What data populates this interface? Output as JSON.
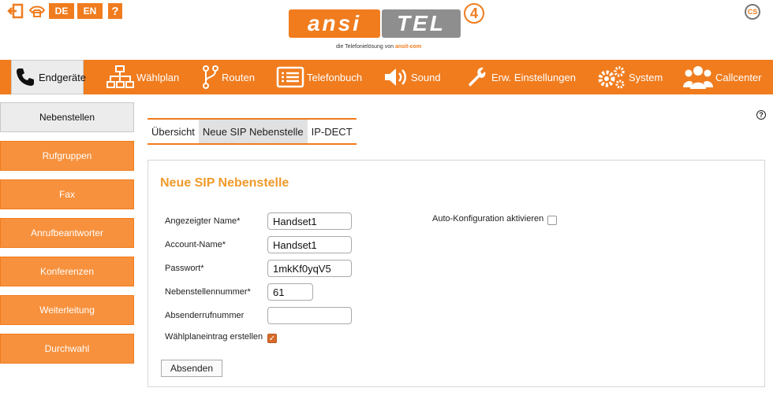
{
  "topbar": {
    "lang_de": "DE",
    "lang_en": "EN",
    "help_label": "?",
    "logo_ansi": "ansi",
    "logo_tel": "TEL",
    "logo_version": "4",
    "tagline_prefix": "die Telefonielösung von",
    "tagline_brand": "ansit-com",
    "cs_logo": "CS"
  },
  "nav": [
    {
      "label": "Endgeräte",
      "icon": "phone-icon",
      "active": true
    },
    {
      "label": "Wählplan",
      "icon": "sitemap-icon"
    },
    {
      "label": "Routen",
      "icon": "route-icon"
    },
    {
      "label": "Telefonbuch",
      "icon": "list-icon"
    },
    {
      "label": "Sound",
      "icon": "speaker-icon"
    },
    {
      "label": "Erw. Einstellungen",
      "icon": "wrench-icon"
    },
    {
      "label": "System",
      "icon": "gears-icon"
    },
    {
      "label": "Callcenter",
      "icon": "users-icon"
    }
  ],
  "sidebar": [
    {
      "label": "Nebenstellen",
      "active": true
    },
    {
      "label": "Rufgruppen"
    },
    {
      "label": "Fax"
    },
    {
      "label": "Anrufbeantworter"
    },
    {
      "label": "Konferenzen"
    },
    {
      "label": "Weiterleitung"
    },
    {
      "label": "Durchwahl"
    }
  ],
  "tabs": [
    {
      "label": "Übersicht"
    },
    {
      "label": "Neue SIP Nebenstelle",
      "active": true
    },
    {
      "label": "IP-DECT"
    }
  ],
  "form": {
    "title": "Neue SIP Nebenstelle",
    "display_name_label": "Angezeigter Name*",
    "display_name_value": "Handset1",
    "account_name_label": "Account-Name*",
    "account_name_value": "Handset1",
    "password_label": "Passwort*",
    "password_value": "1mkKf0yqV5",
    "extension_label": "Nebenstellennummer*",
    "extension_value": "61",
    "caller_number_label": "Absenderrufnummer",
    "caller_number_value": "",
    "dialplan_entry_label": "Wählplaneintrag erstellen",
    "dialplan_entry_checked": true,
    "auto_config_label": "Auto-Konfiguration aktivieren",
    "auto_config_checked": false,
    "submit_label": "Absenden"
  },
  "colors": {
    "accent": "#f07c1e",
    "sidebar_button": "#f7913d",
    "title": "#f09a2a"
  }
}
